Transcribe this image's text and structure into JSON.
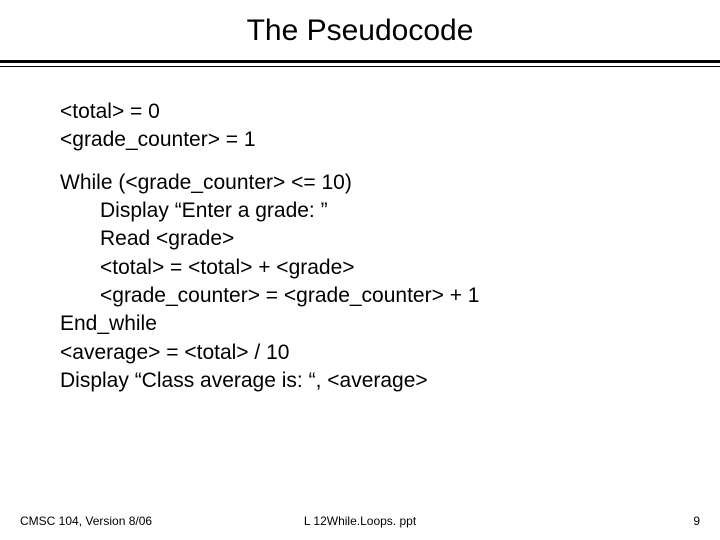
{
  "slide": {
    "title": "The Pseudocode",
    "lines": {
      "l1": "<total> = 0",
      "l2": "<grade_counter> = 1",
      "l3": "While  (<grade_counter> <= 10)",
      "l4": "Display “Enter a grade: ”",
      "l5": "Read <grade>",
      "l6": "<total> = <total> + <grade>",
      "l7": "<grade_counter> = <grade_counter> + 1",
      "l8": "End_while",
      "l9": "<average> = <total> / 10",
      "l10": "Display “Class average is: “, <average>"
    },
    "footer": {
      "left": "CMSC 104, Version 8/06",
      "center": "L 12While.Loops. ppt",
      "right": "9"
    }
  }
}
